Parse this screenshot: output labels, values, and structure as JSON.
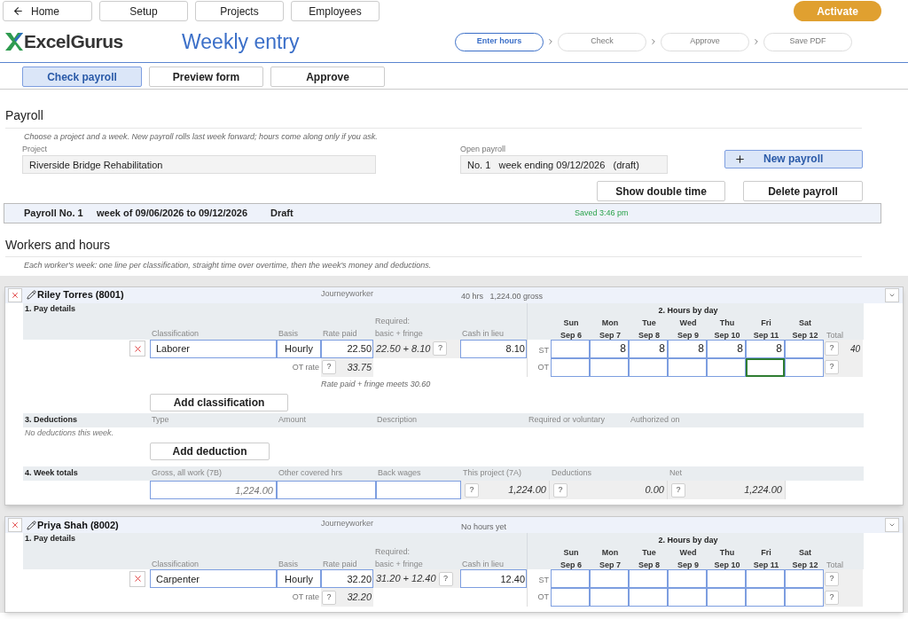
{
  "nav": [
    {
      "label": "Home",
      "kind": "back"
    },
    {
      "label": "Setup",
      "kind": "plain"
    },
    {
      "label": "Projects",
      "kind": "plain"
    },
    {
      "label": "Employees",
      "kind": "plain"
    }
  ],
  "activate": "Activate",
  "help": "?",
  "logo": "ExcelGurus",
  "page_title": "Weekly entry",
  "steps": [
    {
      "label": "Enter hours",
      "selected": true
    },
    {
      "label": "Check",
      "selected": false
    },
    {
      "label": "Approve",
      "selected": false
    },
    {
      "label": "Save PDF",
      "selected": false
    }
  ],
  "tabs": [
    {
      "label": "Check payroll",
      "selected": true
    },
    {
      "label": "Preview form",
      "selected": false
    },
    {
      "label": "Approve",
      "selected": false
    }
  ],
  "payroll": {
    "title": "Payroll",
    "hint": "Choose a project and a week. New payroll rolls last week forward; hours come along only if you ask.",
    "project_label": "Project",
    "project": "Riverside Bridge Rehabilitation",
    "open_label": "Open payroll",
    "open_payroll": "No. 1   week ending 09/12/2026   (draft)",
    "new_button": "New payroll",
    "double_time_button": "Show double time",
    "delete_button": "Delete payroll",
    "status": {
      "number": "Payroll No. 1",
      "week": "week of 09/06/2026 to 09/12/2026",
      "state": "Draft",
      "saved": "Saved 3:46 pm"
    }
  },
  "workers_title": "Workers and hours",
  "workers_hint": "Each worker's week: one line per classification, straight time over overtime, then the week's money and deductions.",
  "workers": [
    {
      "name": "Riley Torres (8001)",
      "grade": "Journeyworker",
      "summary": "40 hrs   1,224.00 gross",
      "pay_title": "1. Pay details",
      "pay_columns": [
        {
          "lines": [
            "Classification"
          ]
        },
        {
          "lines": [
            "Basis"
          ]
        },
        {
          "lines": [
            "Rate paid"
          ]
        },
        {
          "lines": [
            "Required:",
            "basic + fringe"
          ]
        },
        {
          "lines": [
            "Cash in lieu"
          ]
        }
      ],
      "hours_title": "2. Hours by day",
      "days": [
        {
          "day": "Sun",
          "date": "Sep 6"
        },
        {
          "day": "Mon",
          "date": "Sep 7"
        },
        {
          "day": "Tue",
          "date": "Sep 8"
        },
        {
          "day": "Wed",
          "date": "Sep 9"
        },
        {
          "day": "Thu",
          "date": "Sep 10"
        },
        {
          "day": "Fri",
          "date": "Sep 11"
        },
        {
          "day": "Sat",
          "date": "Sep 12"
        }
      ],
      "total_label": "Total",
      "lines": [
        {
          "classification": "Laborer",
          "basis": "Hourly",
          "rate_paid": "22.50",
          "required": "22.50 + 8.10",
          "cash_in_lieu": "8.10",
          "st_label": "ST",
          "st": [
            {
              "focused": false
            },
            {
              "value": "8",
              "focused": false
            },
            {
              "value": "8",
              "focused": false
            },
            {
              "value": "8",
              "focused": false
            },
            {
              "value": "8",
              "focused": false
            },
            {
              "value": "8",
              "focused": false
            },
            {
              "focused": false
            }
          ],
          "st_total": "40",
          "ot_rate_label": "OT rate",
          "ot_rate": "33.75",
          "ot_label": "OT",
          "ot": [
            {
              "focused": false
            },
            {
              "focused": false
            },
            {
              "focused": false
            },
            {
              "focused": false
            },
            {
              "focused": false
            },
            {
              "focused": true
            },
            {
              "focused": false
            }
          ],
          "note": "Rate paid + fringe meets 30.60"
        }
      ],
      "add_classification": "Add classification",
      "deductions": {
        "title": "3. Deductions",
        "columns": [
          "Type",
          "Amount",
          "Description",
          "Required or voluntary",
          "Authorized on"
        ],
        "empty": "No deductions this week.",
        "add_button": "Add deduction"
      },
      "totals": {
        "title": "4. Week totals",
        "columns": [
          "Gross, all work (7B)",
          "Other covered hrs",
          "Back wages",
          "This project (7A)",
          "Deductions",
          "Net"
        ],
        "gross": "1,224.00",
        "this_project": "1,224.00",
        "deductions": "0.00",
        "net": "1,224.00"
      }
    },
    {
      "name": "Priya Shah (8002)",
      "grade": "Journeyworker",
      "summary": "No hours yet",
      "pay_title": "1. Pay details",
      "pay_columns": [
        {
          "lines": [
            "Classification"
          ]
        },
        {
          "lines": [
            "Basis"
          ]
        },
        {
          "lines": [
            "Rate paid"
          ]
        },
        {
          "lines": [
            "Required:",
            "basic + fringe"
          ]
        },
        {
          "lines": [
            "Cash in lieu"
          ]
        }
      ],
      "hours_title": "2. Hours by day",
      "days": [
        {
          "day": "Sun",
          "date": "Sep 6"
        },
        {
          "day": "Mon",
          "date": "Sep 7"
        },
        {
          "day": "Tue",
          "date": "Sep 8"
        },
        {
          "day": "Wed",
          "date": "Sep 9"
        },
        {
          "day": "Thu",
          "date": "Sep 10"
        },
        {
          "day": "Fri",
          "date": "Sep 11"
        },
        {
          "day": "Sat",
          "date": "Sep 12"
        }
      ],
      "total_label": "Total",
      "lines": [
        {
          "classification": "Carpenter",
          "basis": "Hourly",
          "rate_paid": "32.20",
          "required": "31.20 + 12.40",
          "cash_in_lieu": "12.40",
          "st_label": "ST",
          "st": [
            {
              "focused": false
            },
            {
              "focused": false
            },
            {
              "focused": false
            },
            {
              "focused": false
            },
            {
              "focused": false
            },
            {
              "focused": false
            },
            {
              "focused": false
            }
          ],
          "ot_rate_label": "OT rate",
          "ot_rate": "32.20",
          "ot_label": "OT",
          "ot": [
            {
              "focused": false
            },
            {
              "focused": false
            },
            {
              "focused": false
            },
            {
              "focused": false
            },
            {
              "focused": false
            },
            {
              "focused": false
            },
            {
              "focused": false
            }
          ]
        }
      ]
    }
  ]
}
